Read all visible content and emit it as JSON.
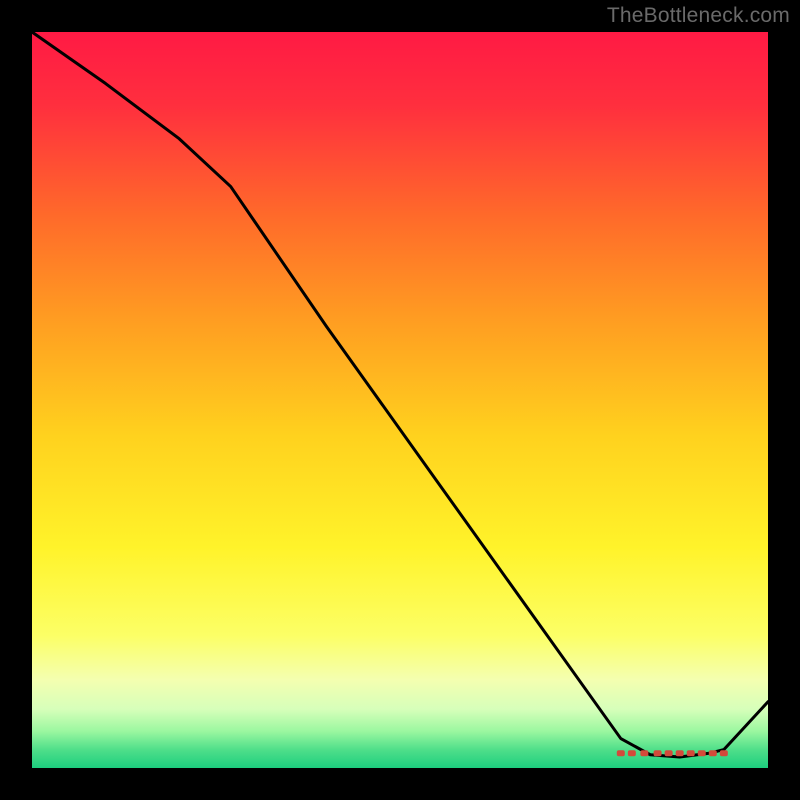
{
  "watermark": "TheBottleneck.com",
  "chart_data": {
    "type": "line",
    "title": "",
    "xlabel": "",
    "ylabel": "",
    "xlim": [
      0,
      100
    ],
    "ylim": [
      0,
      100
    ],
    "series": [
      {
        "name": "curve",
        "x": [
          0,
          10,
          20,
          27,
          40,
          55,
          70,
          80,
          84,
          88,
          92,
          94,
          100
        ],
        "y": [
          100,
          93,
          85.5,
          79,
          60,
          39,
          18,
          4,
          1.8,
          1.5,
          2,
          2.5,
          9
        ]
      }
    ],
    "markers": {
      "name": "optimal-range",
      "x": [
        80,
        81.5,
        83.2,
        85,
        86.5,
        88,
        89.5,
        91,
        92.5,
        94
      ],
      "y": [
        2.0,
        2.0,
        2.0,
        2.0,
        2.0,
        2.0,
        2.0,
        2.0,
        2.0,
        2.0
      ]
    },
    "gradient_stops": [
      {
        "pos": 0.0,
        "color": "#ff1a44"
      },
      {
        "pos": 0.1,
        "color": "#ff2f3e"
      },
      {
        "pos": 0.25,
        "color": "#ff6a2a"
      },
      {
        "pos": 0.4,
        "color": "#ffa021"
      },
      {
        "pos": 0.55,
        "color": "#ffd21e"
      },
      {
        "pos": 0.7,
        "color": "#fff32a"
      },
      {
        "pos": 0.82,
        "color": "#fcff66"
      },
      {
        "pos": 0.88,
        "color": "#f4ffb0"
      },
      {
        "pos": 0.92,
        "color": "#d7ffba"
      },
      {
        "pos": 0.95,
        "color": "#9bf7a0"
      },
      {
        "pos": 0.975,
        "color": "#4fdf8a"
      },
      {
        "pos": 1.0,
        "color": "#1dce7e"
      }
    ]
  }
}
